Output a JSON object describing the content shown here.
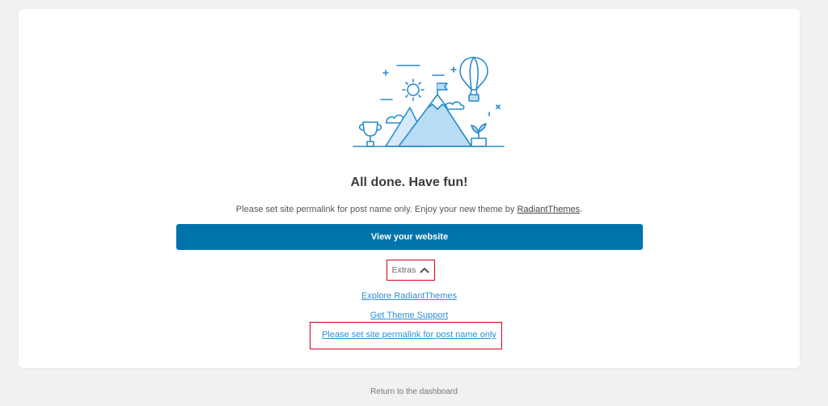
{
  "setup": {
    "title": "All done. Have fun!",
    "subtitle_prefix": "Please set site permalink for post name only. Enjoy your new theme by ",
    "subtitle_link": "RadiantThemes",
    "subtitle_suffix": ".",
    "primary_button": "View your website",
    "extras_label": "Extras",
    "extras_links": [
      "Explore RadiantThemes",
      "Get Theme Support",
      "Please set site permalink for post name only"
    ]
  },
  "footer": {
    "link": "Return to the dashboard"
  },
  "colors": {
    "background": "#f1f1f1",
    "card": "#ffffff",
    "primary": "#0073aa",
    "link": "#2e8fd6",
    "highlight": "#d0021b",
    "illustration_stroke": "#2a8bc9",
    "illustration_fill": "#b9dcf5"
  },
  "icons": {
    "illustration": "mountain-balloon-illustration",
    "extras_toggle": "chevron-up-icon"
  }
}
